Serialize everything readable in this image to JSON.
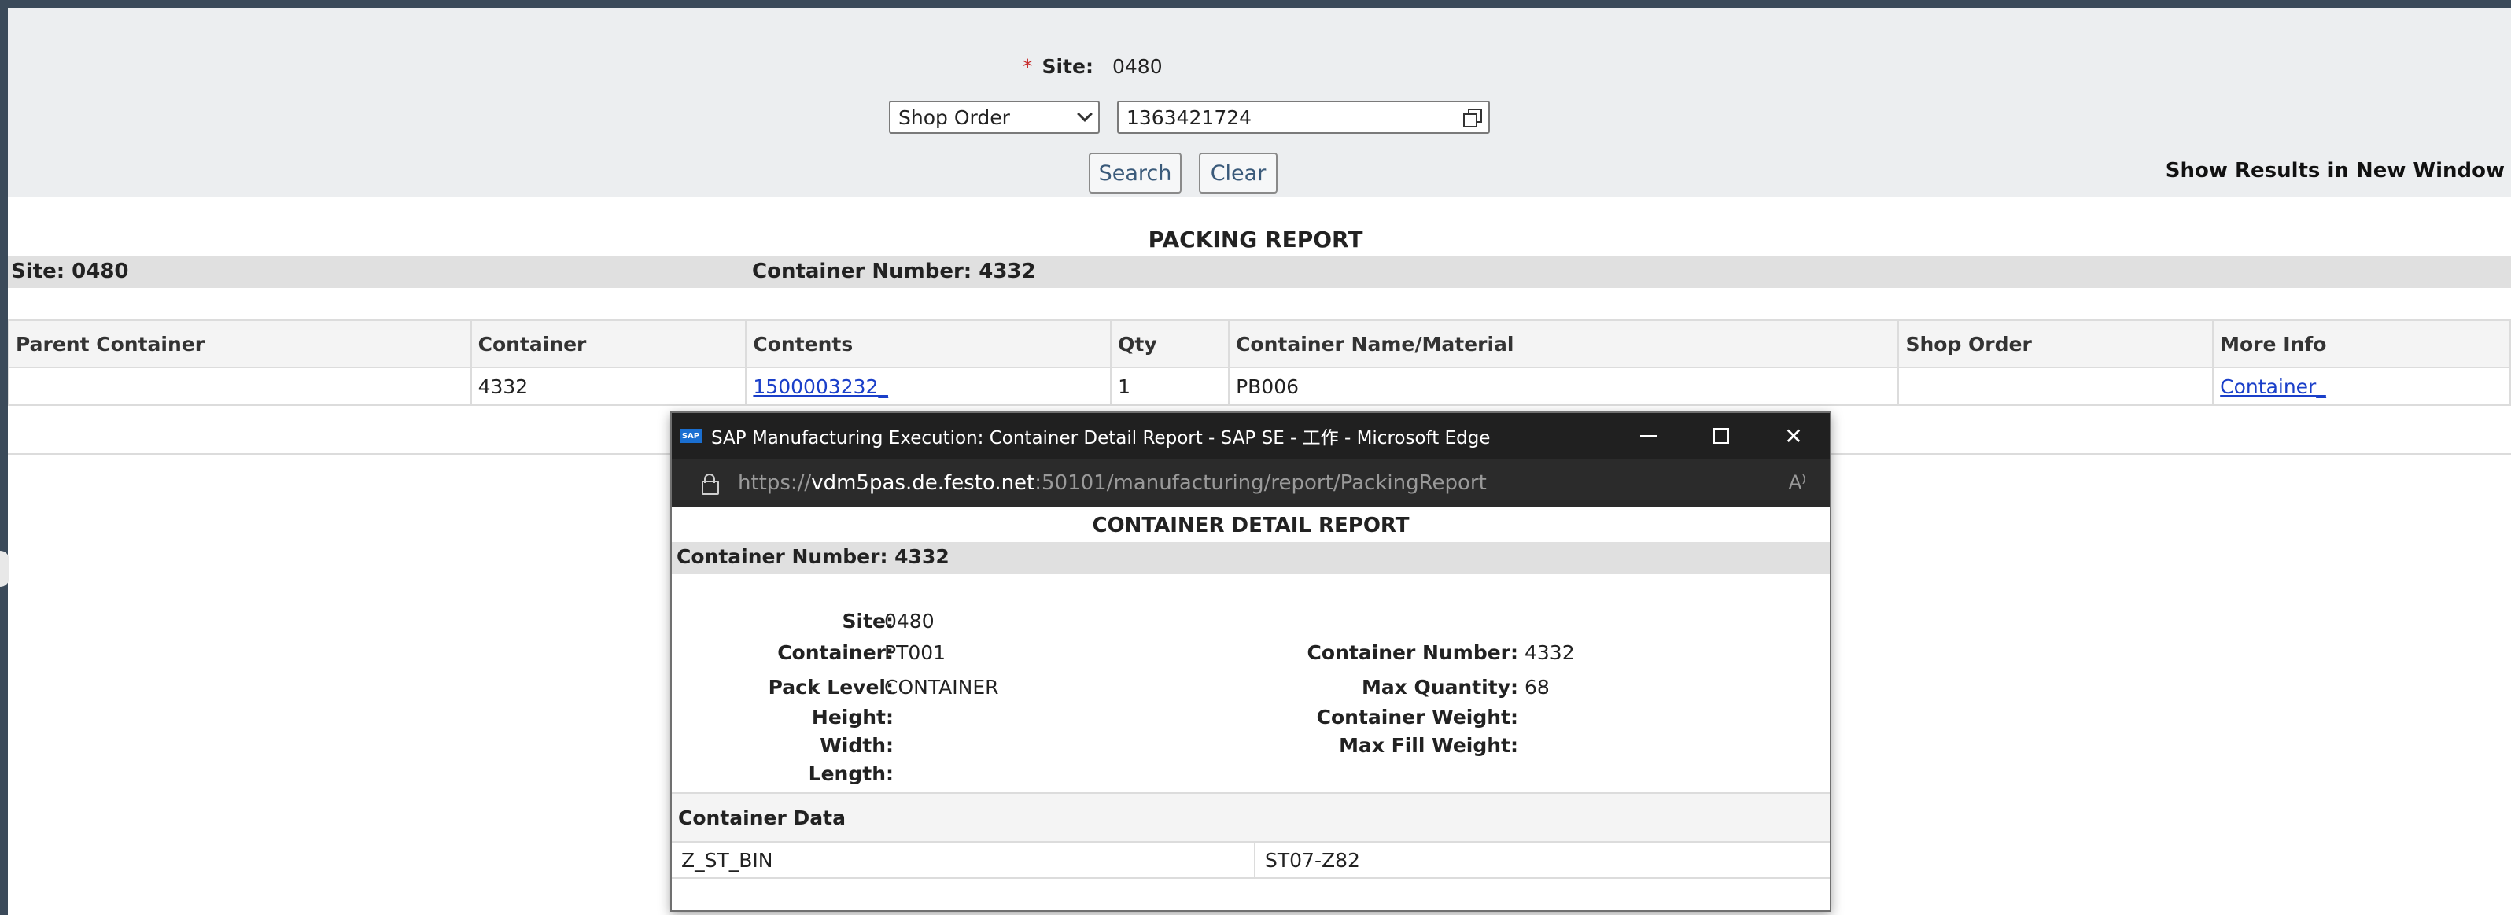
{
  "search": {
    "site_label": "Site:",
    "site_value": "0480",
    "type_select": "Shop Order",
    "order_value": "1363421724",
    "search_button": "Search",
    "clear_button": "Clear",
    "new_window_label": "Show Results in New Window"
  },
  "report": {
    "title": "PACKING REPORT",
    "site": "Site: 0480",
    "container_number": "Container Number: 4332",
    "columns": [
      "Parent Container",
      "Container",
      "Contents",
      "Qty",
      "Container Name/Material",
      "Shop Order",
      "More Info"
    ],
    "row": {
      "parent": "",
      "container": "4332",
      "contents": "1500003232_",
      "qty": "1",
      "name_material": "PB006",
      "shop_order": "",
      "more_info": "Container_"
    }
  },
  "popup": {
    "window_title": "SAP Manufacturing Execution: Container Detail Report - SAP SE - 工作 - Microsoft Edge",
    "url_prefix": "https://",
    "url_host": "vdm5pas.de.festo.net",
    "url_rest": ":50101/manufacturing/report/PackingReport",
    "report_title": "CONTAINER DETAIL REPORT",
    "container_number_header": "Container Number: 4332",
    "fields": {
      "site_label": "Site:",
      "site_value": "0480",
      "container_label": "Container:",
      "container_value": "PT001",
      "pack_level_label": "Pack Level:",
      "pack_level_value": "CONTAINER",
      "height_label": "Height:",
      "width_label": "Width:",
      "length_label": "Length:",
      "container_number_label": "Container Number:",
      "container_number_value": "4332",
      "max_quantity_label": "Max Quantity:",
      "max_quantity_value": "68",
      "container_weight_label": "Container Weight:",
      "max_fill_weight_label": "Max Fill Weight:"
    },
    "container_data_header": "Container Data",
    "container_data_key": "Z_ST_BIN",
    "container_data_value": "ST07-Z82"
  }
}
